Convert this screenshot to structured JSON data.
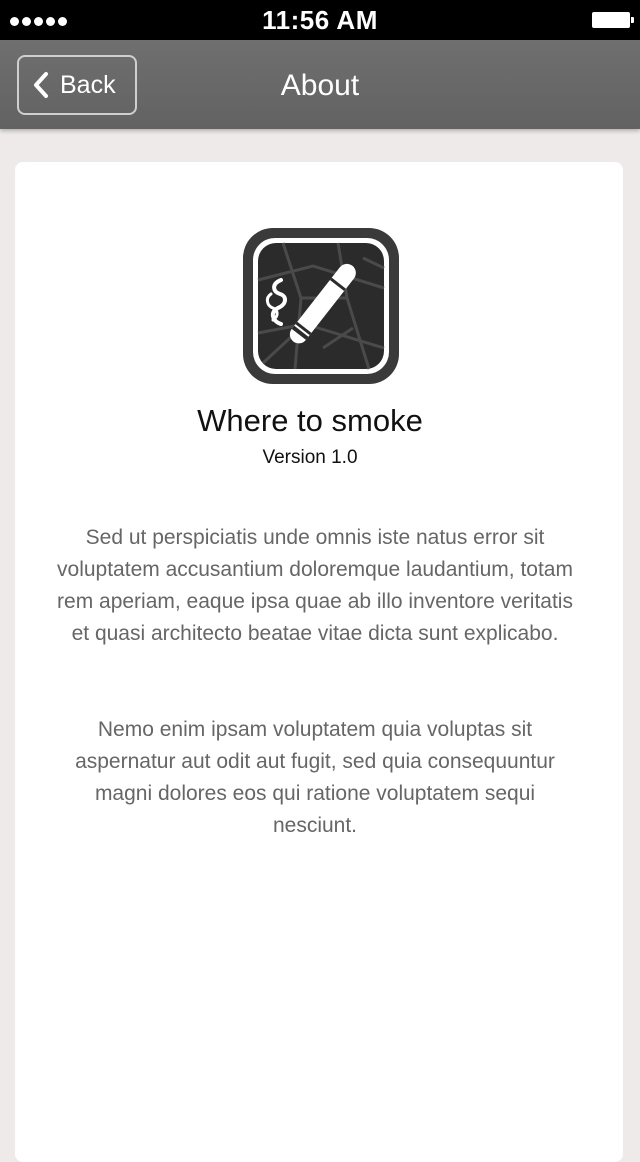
{
  "status_bar": {
    "time": "11:56 AM",
    "signal_icon": "signal-dots-icon",
    "battery_icon": "battery-icon"
  },
  "nav": {
    "back_label": "Back",
    "back_icon": "chevron-left-icon",
    "title": "About"
  },
  "about": {
    "icon": "cigarette-map-app-icon",
    "app_name": "Where to smoke",
    "version": "Version 1.0",
    "paragraphs": [
      "Sed ut perspiciatis unde omnis iste natus error sit voluptatem accusantium doloremque laudantium, totam rem aperiam, eaque ipsa quae ab illo inventore veritatis et quasi architecto beatae vitae dicta sunt explicabo.",
      "Nemo enim ipsam voluptatem quia voluptas sit aspernatur aut odit aut fugit, sed quia consequuntur magni dolores eos qui ratione voluptatem sequi nesciunt."
    ]
  },
  "colors": {
    "nav_bar": "#666666",
    "background": "#eeeaea",
    "card": "#ffffff",
    "body_text": "#666666"
  }
}
